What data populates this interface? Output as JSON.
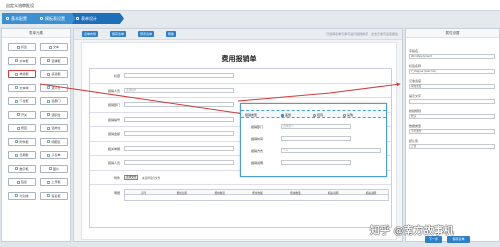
{
  "window": {
    "title": "自定义流审批设"
  },
  "steps": [
    {
      "label": "基本配置"
    },
    {
      "label": "模板表设置"
    },
    {
      "label": "表单设计"
    }
  ],
  "left_panel": {
    "title": "表单元素",
    "controls": [
      [
        "标签",
        "文本"
      ],
      [
        "文本框",
        "选择框"
      ],
      [
        "单选框",
        "多选框"
      ],
      [
        "文本域",
        "选人员"
      ],
      [
        "下拉框",
        "选部门"
      ],
      [
        "开关",
        "选职位"
      ],
      [
        "按钮",
        "选岗位"
      ],
      [
        "附件框",
        "明细表"
      ],
      [
        "日期框",
        "子表单"
      ],
      [
        "数字框",
        "图片"
      ],
      [
        "链接",
        "上传框"
      ],
      [
        "分割线",
        "签名框"
      ]
    ]
  },
  "toolbar": {
    "buttons": [
      "表单布局",
      "保存表单",
      "预览表单",
      "帮助"
    ],
    "hint": "已选择表单元素可进行拖拽排序 · 点击元素可设置属性"
  },
  "form": {
    "title": "费用报销单",
    "rows": [
      {
        "label": "标题",
        "placeholder": ""
      },
      {
        "label": "报销人员",
        "placeholder": "选择用户"
      },
      {
        "label": "报销部门",
        "placeholder": ""
      },
      {
        "label": "报销编号",
        "placeholder": ""
      },
      {
        "label": "报销金额",
        "placeholder": ""
      },
      {
        "label": "相关单据",
        "placeholder": ""
      },
      {
        "label": "报销人员",
        "placeholder": ""
      }
    ],
    "attachment": {
      "label": "附件",
      "button": "选择文件",
      "text": "未选择任何文件"
    },
    "detail_label": "明细",
    "detail_headers": [
      "序号",
      "费用日期",
      "费用类别",
      "费用金额",
      "费用数量",
      "相关说明",
      "相关说明"
    ]
  },
  "popup": {
    "radio_label": "报销类型",
    "options": [
      "差旅",
      "招待",
      "采购"
    ],
    "fields": [
      {
        "label": "报销部门",
        "value": "选择部门"
      },
      {
        "label": "报销时间",
        "value": ""
      },
      {
        "label": "报销方式",
        "value": "个人"
      },
      {
        "label": "报销说明",
        "value": ""
      }
    ]
  },
  "right_panel": {
    "title": "属性设置",
    "props": [
      {
        "label": "字段名",
        "value": "WordApplyment"
      },
      {
        "label": "标签名称",
        "value": "7_Degree (text hix)"
      },
      {
        "label": "元素宽度",
        "value": "填充宽度"
      },
      {
        "label": "提示文字",
        "value": ""
      },
      {
        "label": "校验规则",
        "value": "默认"
      },
      {
        "label": "数据类型",
        "value": "字符类型"
      },
      {
        "label": "默认值",
        "value": "正常"
      }
    ],
    "next": "下一步",
    "save": "保存表单"
  },
  "watermark": "知乎 @南方故事机",
  "colors": {
    "accent": "#2e7fc6",
    "highlight": "#d23b3b"
  }
}
